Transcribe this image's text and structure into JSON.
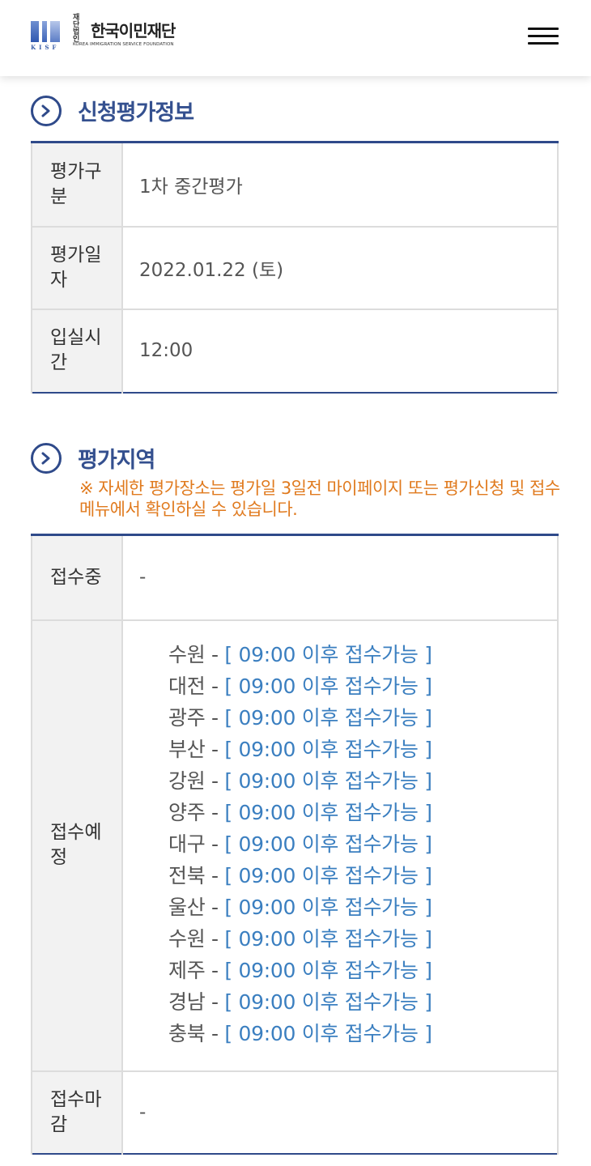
{
  "header": {
    "logo": {
      "corp_label": "재단법인",
      "name": "한국이민재단",
      "english": "KOREA IMMIGRATION SERVICE FOUNDATION",
      "abbr": "KISF"
    },
    "menu_icon": "hamburger-menu-icon"
  },
  "colors": {
    "accent_navy": "#2f4a8a",
    "title_blue": "#34508f",
    "notice_orange": "#e07a1e",
    "status_blue": "#3b7fc0"
  },
  "application_info": {
    "title": "신청평가정보",
    "icon": "chevron-right-circle-icon",
    "rows": [
      {
        "label": "평가구분",
        "value": "1차 중간평가"
      },
      {
        "label": "평가일자",
        "value": "2022.01.22 (토)"
      },
      {
        "label": "입실시간",
        "value": "12:00"
      }
    ]
  },
  "region_info": {
    "title": "평가지역",
    "icon": "chevron-right-circle-icon",
    "notice": "※ 자세한 평가장소는 평가일 3일전 마이페이지 또는 평가신청 및 접수 메뉴에서 확인하실 수 있습니다.",
    "receiving": {
      "label": "접수중",
      "value": "-"
    },
    "scheduled": {
      "label": "접수예정",
      "separator": " - ",
      "regions": [
        {
          "name": "수원",
          "status": "[ 09:00 이후 접수가능 ]"
        },
        {
          "name": "대전",
          "status": "[ 09:00 이후 접수가능 ]"
        },
        {
          "name": "광주",
          "status": "[ 09:00 이후 접수가능 ]"
        },
        {
          "name": "부산",
          "status": "[ 09:00 이후 접수가능 ]"
        },
        {
          "name": "강원",
          "status": "[ 09:00 이후 접수가능 ]"
        },
        {
          "name": "양주",
          "status": "[ 09:00 이후 접수가능 ]"
        },
        {
          "name": "대구",
          "status": "[ 09:00 이후 접수가능 ]"
        },
        {
          "name": "전북",
          "status": "[ 09:00 이후 접수가능 ]"
        },
        {
          "name": "울산",
          "status": "[ 09:00 이후 접수가능 ]"
        },
        {
          "name": "수원",
          "status": "[ 09:00 이후 접수가능 ]"
        },
        {
          "name": "제주",
          "status": "[ 09:00 이후 접수가능 ]"
        },
        {
          "name": "경남",
          "status": "[ 09:00 이후 접수가능 ]"
        },
        {
          "name": "충북",
          "status": "[ 09:00 이후 접수가능 ]"
        }
      ]
    },
    "closed": {
      "label": "접수마감",
      "value": "-"
    }
  }
}
